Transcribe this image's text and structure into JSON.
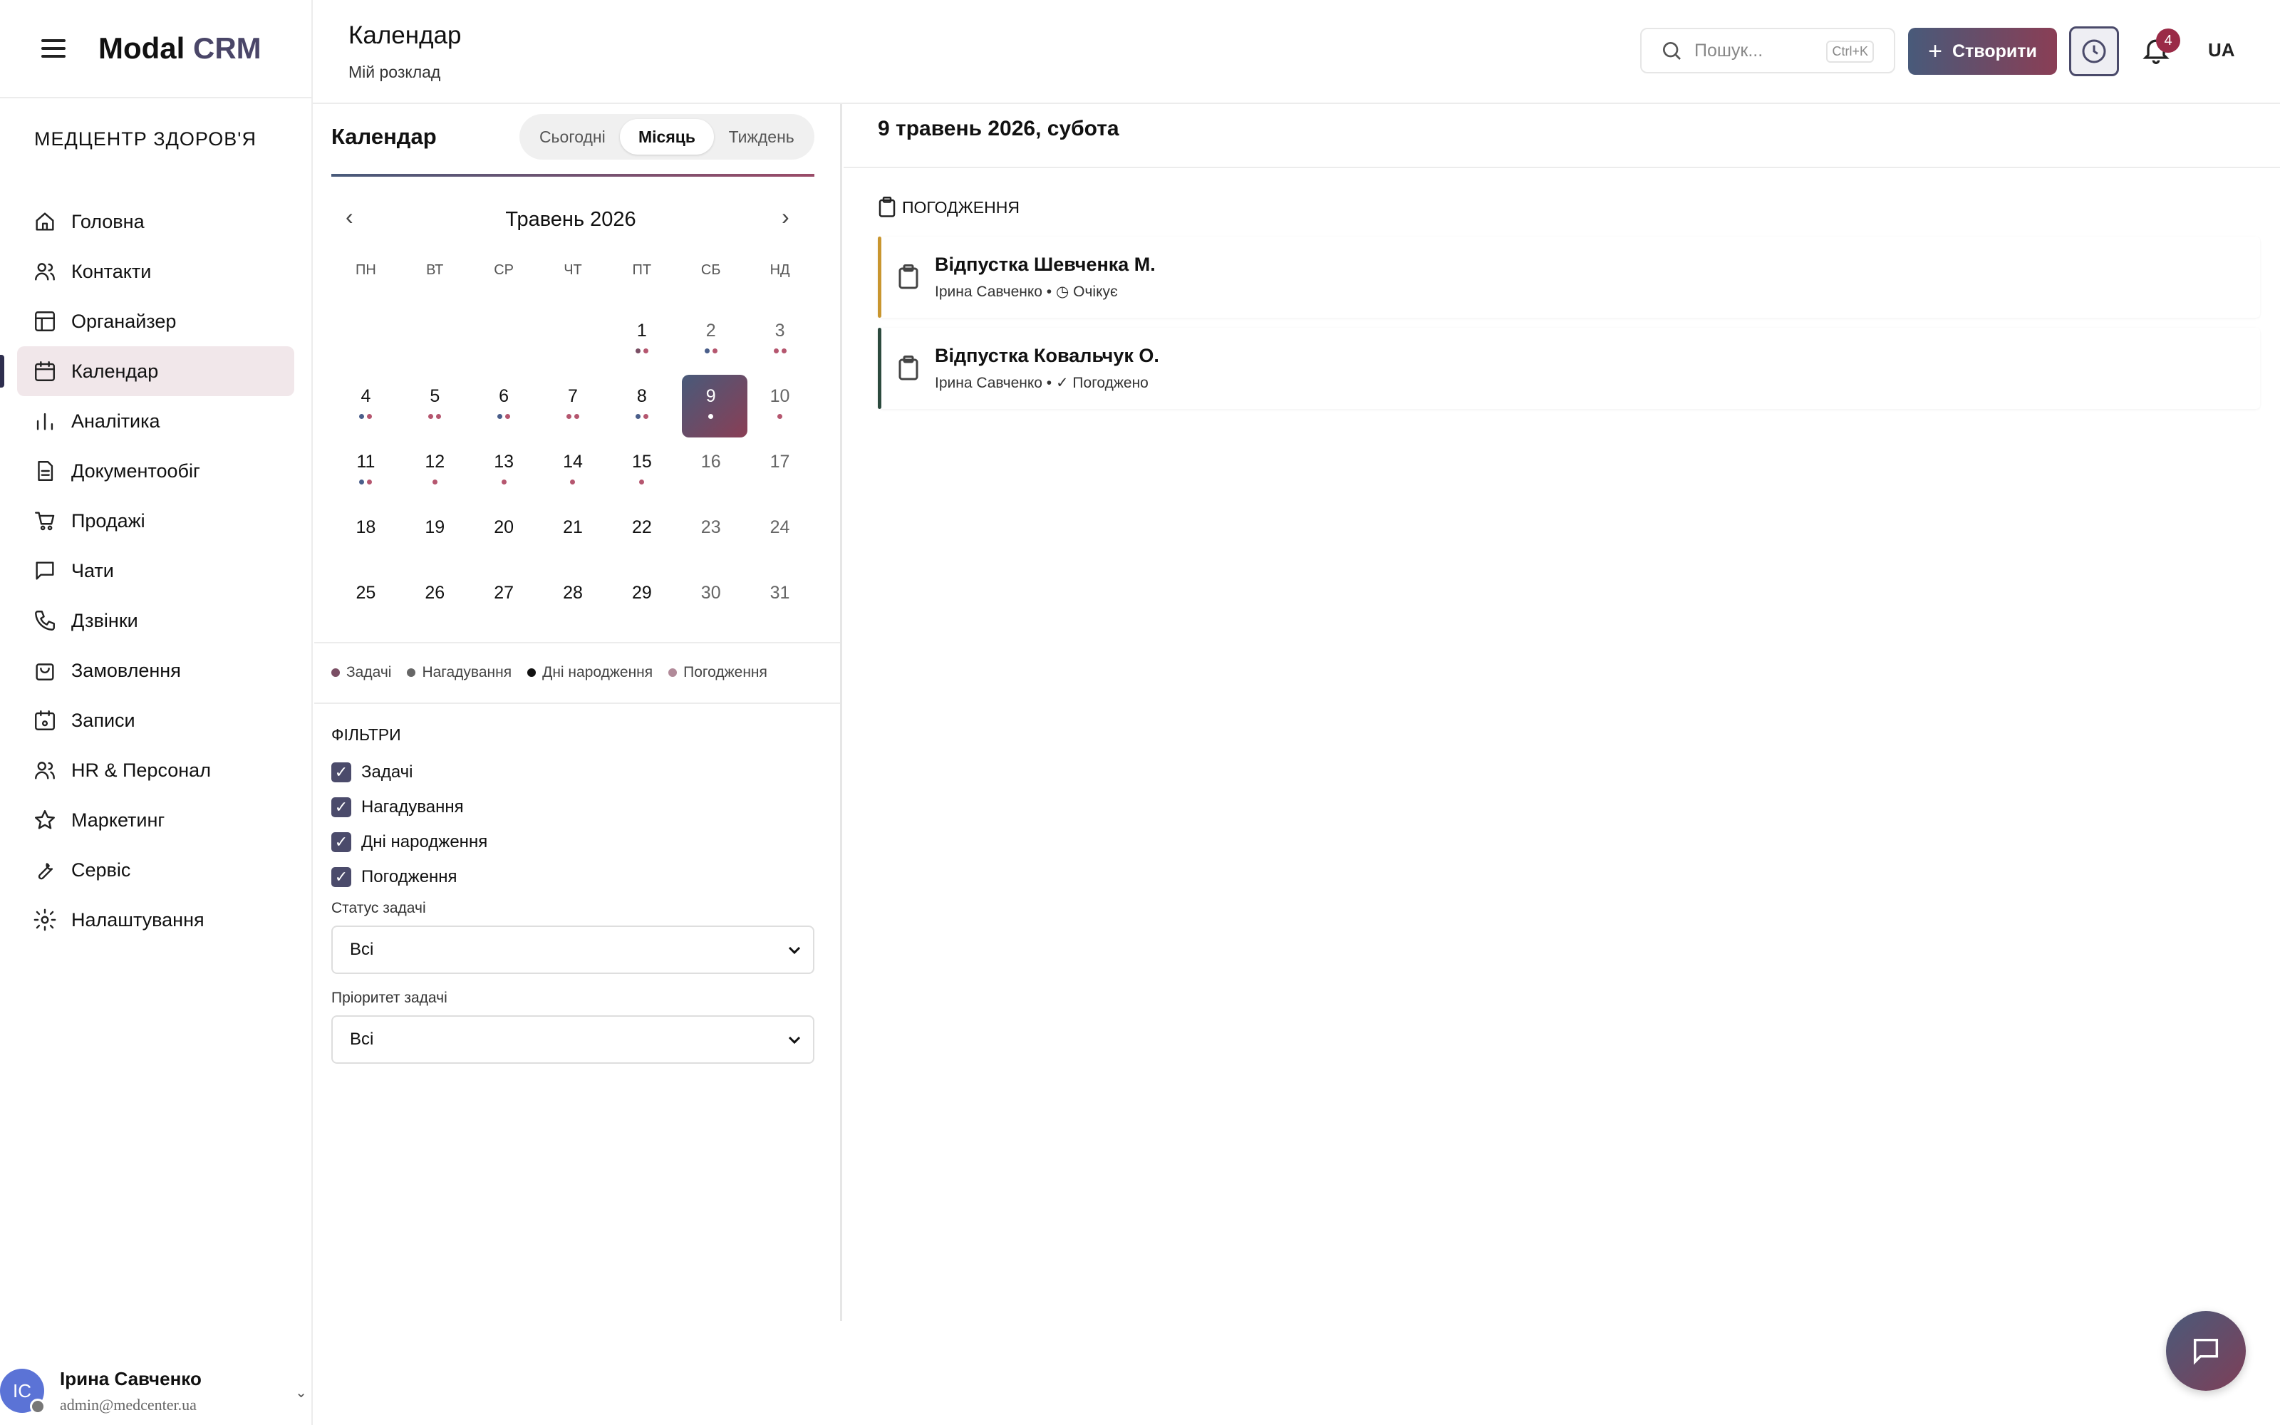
{
  "brand": {
    "name": "Modal",
    "suffix": "CRM"
  },
  "org": "МЕДЦЕНТР ЗДОРОВ'Я",
  "nav": [
    {
      "label": "Головна",
      "icon": "home-icon"
    },
    {
      "label": "Контакти",
      "icon": "users-icon"
    },
    {
      "label": "Органайзер",
      "icon": "layout-icon"
    },
    {
      "label": "Календар",
      "icon": "calendar-icon",
      "active": true
    },
    {
      "label": "Аналітика",
      "icon": "chart-icon"
    },
    {
      "label": "Документообіг",
      "icon": "document-icon"
    },
    {
      "label": "Продажі",
      "icon": "cart-icon"
    },
    {
      "label": "Чати",
      "icon": "chat-icon"
    },
    {
      "label": "Дзвінки",
      "icon": "phone-icon"
    },
    {
      "label": "Замовлення",
      "icon": "bag-icon"
    },
    {
      "label": "Записи",
      "icon": "calendar-check-icon"
    },
    {
      "label": "HR & Персонал",
      "icon": "team-icon"
    },
    {
      "label": "Маркетинг",
      "icon": "star-icon"
    },
    {
      "label": "Сервіс",
      "icon": "wrench-icon"
    },
    {
      "label": "Налаштування",
      "icon": "gear-icon"
    }
  ],
  "user": {
    "initials": "ІС",
    "name": "Ірина Савченко",
    "email": "admin@medcenter.ua"
  },
  "header": {
    "title": "Календар",
    "subtitle": "Мій розклад",
    "search_placeholder": "Пошук...",
    "search_shortcut": "Ctrl+K",
    "create_label": "Створити",
    "notifications_count": "4",
    "lang": "UA"
  },
  "calendar": {
    "title": "Календар",
    "views": [
      "Сьогодні",
      "Місяць",
      "Тиждень"
    ],
    "active_view": "Місяць",
    "month_label": "Травень 2026",
    "weekdays": [
      "ПН",
      "ВТ",
      "СР",
      "ЧТ",
      "ПТ",
      "СБ",
      "НД"
    ],
    "selected_day": "9",
    "weeks": [
      [
        null,
        null,
        null,
        null,
        {
          "d": "1",
          "dots": [
            "task",
            "appr"
          ]
        },
        {
          "d": "2",
          "dots": [
            "rem",
            "appr"
          ]
        },
        {
          "d": "3",
          "dots": [
            "appr",
            "appr"
          ]
        }
      ],
      [
        {
          "d": "4",
          "dots": [
            "rem",
            "appr"
          ]
        },
        {
          "d": "5",
          "dots": [
            "appr",
            "appr"
          ]
        },
        {
          "d": "6",
          "dots": [
            "rem",
            "appr"
          ]
        },
        {
          "d": "7",
          "dots": [
            "appr",
            "appr"
          ]
        },
        {
          "d": "8",
          "dots": [
            "rem",
            "appr"
          ]
        },
        {
          "d": "9",
          "dots": [
            "white"
          ]
        },
        {
          "d": "10",
          "dots": [
            "appr"
          ]
        }
      ],
      [
        {
          "d": "11",
          "dots": [
            "rem",
            "appr"
          ]
        },
        {
          "d": "12",
          "dots": [
            "appr"
          ]
        },
        {
          "d": "13",
          "dots": [
            "appr"
          ]
        },
        {
          "d": "14",
          "dots": [
            "appr"
          ]
        },
        {
          "d": "15",
          "dots": [
            "appr"
          ]
        },
        {
          "d": "16",
          "dots": []
        },
        {
          "d": "17",
          "dots": []
        }
      ],
      [
        {
          "d": "18",
          "dots": []
        },
        {
          "d": "19",
          "dots": []
        },
        {
          "d": "20",
          "dots": []
        },
        {
          "d": "21",
          "dots": []
        },
        {
          "d": "22",
          "dots": []
        },
        {
          "d": "23",
          "dots": []
        },
        {
          "d": "24",
          "dots": []
        }
      ],
      [
        {
          "d": "25",
          "dots": []
        },
        {
          "d": "26",
          "dots": []
        },
        {
          "d": "27",
          "dots": []
        },
        {
          "d": "28",
          "dots": []
        },
        {
          "d": "29",
          "dots": []
        },
        {
          "d": "30",
          "dots": []
        },
        {
          "d": "31",
          "dots": []
        }
      ]
    ],
    "legend": [
      {
        "label": "Задачі",
        "color": "#7a4e64"
      },
      {
        "label": "Нагадування",
        "color": "#666666"
      },
      {
        "label": "Дні народження",
        "color": "#111111"
      },
      {
        "label": "Погодження",
        "color": "#b18a99"
      }
    ],
    "dot_colors": {
      "task": "#7a4e64",
      "rem": "#4a5e8a",
      "appr": "#b5566f",
      "white": "#ffffff"
    }
  },
  "filters": {
    "title": "ФІЛЬТРИ",
    "checkboxes": [
      "Задачі",
      "Нагадування",
      "Дні народження",
      "Погодження"
    ],
    "status_label": "Статус задачі",
    "status_value": "Всі",
    "priority_label": "Пріоритет задачі",
    "priority_value": "Всі"
  },
  "day_view": {
    "date": "9 травень 2026, субота",
    "section": "ПОГОДЖЕННЯ",
    "items": [
      {
        "title": "Відпустка Шевченка М.",
        "meta": "Ірина Савченко • ◷ Очікує",
        "color": "#c9962f"
      },
      {
        "title": "Відпустка Ковальчук О.",
        "meta": "Ірина Савченко • ✓ Погоджено",
        "color": "#2c4a3e"
      }
    ]
  }
}
